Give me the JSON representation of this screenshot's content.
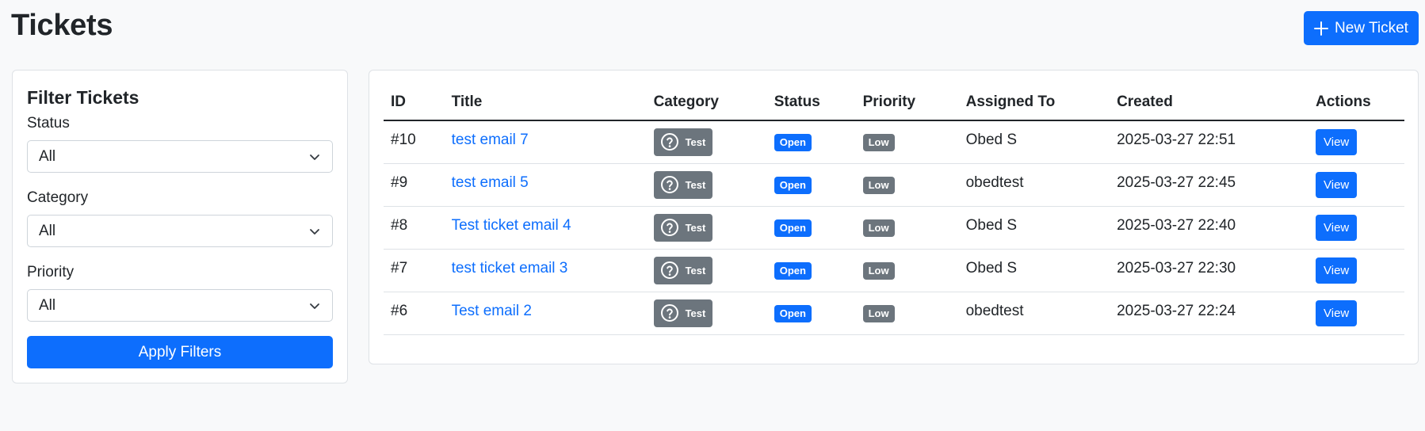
{
  "page": {
    "title": "Tickets"
  },
  "header": {
    "new_ticket_label": "New Ticket"
  },
  "filters": {
    "title": "Filter Tickets",
    "status": {
      "label": "Status",
      "value": "All"
    },
    "category": {
      "label": "Category",
      "value": "All"
    },
    "priority": {
      "label": "Priority",
      "value": "All"
    },
    "apply_label": "Apply Filters"
  },
  "table": {
    "headers": {
      "id": "ID",
      "title": "Title",
      "category": "Category",
      "status": "Status",
      "priority": "Priority",
      "assigned": "Assigned To",
      "created": "Created",
      "actions": "Actions"
    },
    "rows": [
      {
        "id": "#10",
        "title": "test email 7",
        "category": "Test",
        "status": "Open",
        "priority": "Low",
        "assigned": "Obed S",
        "created": "2025-03-27 22:51",
        "action": "View"
      },
      {
        "id": "#9",
        "title": "test email 5",
        "category": "Test",
        "status": "Open",
        "priority": "Low",
        "assigned": "obedtest",
        "created": "2025-03-27 22:45",
        "action": "View"
      },
      {
        "id": "#8",
        "title": "Test ticket email 4",
        "category": "Test",
        "status": "Open",
        "priority": "Low",
        "assigned": "Obed S",
        "created": "2025-03-27 22:40",
        "action": "View"
      },
      {
        "id": "#7",
        "title": "test ticket email 3",
        "category": "Test",
        "status": "Open",
        "priority": "Low",
        "assigned": "Obed S",
        "created": "2025-03-27 22:30",
        "action": "View"
      },
      {
        "id": "#6",
        "title": "Test email 2",
        "category": "Test",
        "status": "Open",
        "priority": "Low",
        "assigned": "obedtest",
        "created": "2025-03-27 22:24",
        "action": "View"
      }
    ]
  },
  "colors": {
    "primary": "#0d6efd",
    "secondary": "#6c757d",
    "background": "#f8f9fa"
  }
}
